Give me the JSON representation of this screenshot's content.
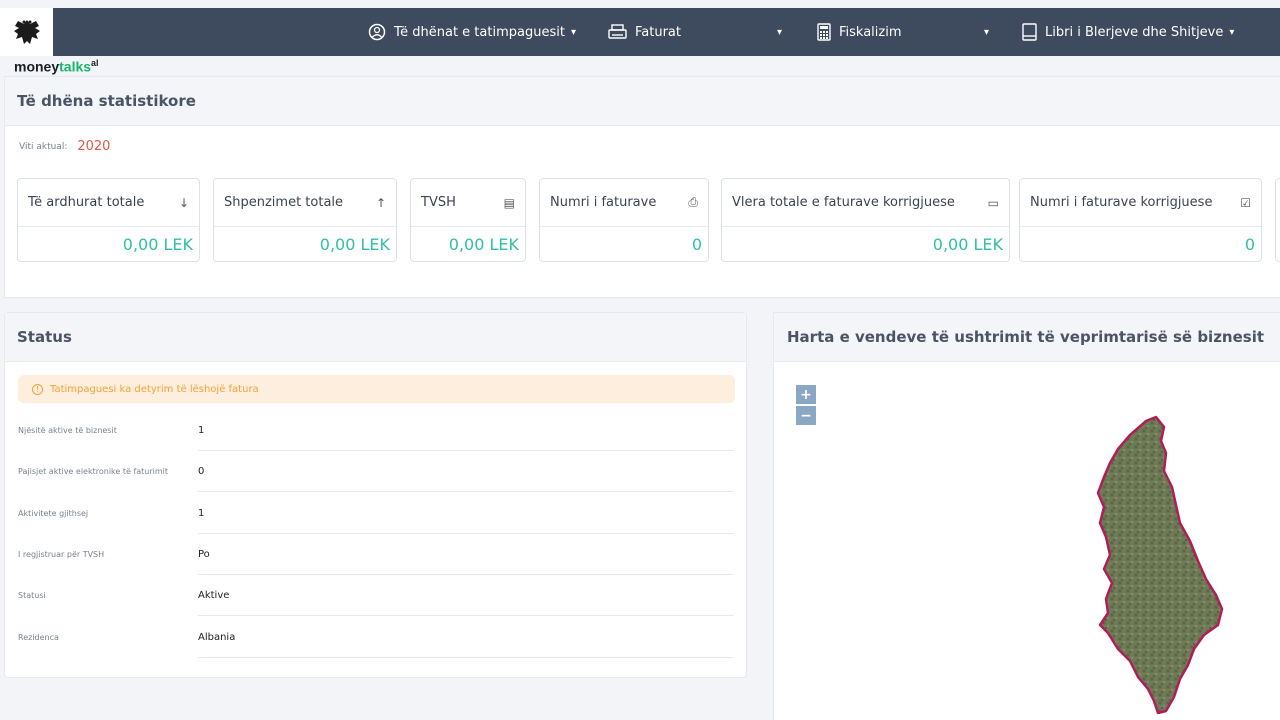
{
  "nav": {
    "items": [
      {
        "label": "Të dhënat e tatimpaguesit",
        "icon": "user-circle-icon"
      },
      {
        "label": "Faturat",
        "icon": "printer-icon"
      },
      {
        "label": "Fiskalizim",
        "icon": "calculator-icon"
      },
      {
        "label": "Libri i Blerjeve dhe Shitjeve",
        "icon": "book-icon"
      }
    ],
    "caret": "▾"
  },
  "brand": {
    "part1": "money",
    "part2": "talks",
    "sup": "al"
  },
  "stats": {
    "title": "Të dhëna statistikore",
    "year_label": "Viti aktual:",
    "year_value": "2020",
    "cards": [
      {
        "label": "Të ardhurat totale",
        "icon": "arrow-down-icon",
        "glyph": "↓",
        "value": "0,00 LEK"
      },
      {
        "label": "Shpenzimet totale",
        "icon": "arrow-up-icon",
        "glyph": "↑",
        "value": "0,00 LEK"
      },
      {
        "label": "TVSH",
        "icon": "calculator-icon",
        "glyph": "▤",
        "value": "0,00 LEK"
      },
      {
        "label": "Numri i faturave",
        "icon": "printer-icon",
        "glyph": "⎙",
        "value": "0"
      },
      {
        "label": "Vlera totale e faturave korrigjuese",
        "icon": "money-icon",
        "glyph": "▭",
        "value": "0,00 LEK"
      },
      {
        "label": "Numri i faturave korrigjuese",
        "icon": "clipboard-icon",
        "glyph": "☑",
        "value": "0"
      }
    ]
  },
  "status": {
    "title": "Status",
    "alert": "Tatimpaguesi ka detyrim të lëshojë fatura",
    "rows": [
      {
        "label": "Njësitë aktive të biznesit",
        "value": "1"
      },
      {
        "label": "Pajisjet aktive elektronike të faturimit",
        "value": "0"
      },
      {
        "label": "Aktivitete gjithsej",
        "value": "1"
      },
      {
        "label": "I regjistruar për TVSH",
        "value": "Po"
      },
      {
        "label": "Statusi",
        "value": "Aktive"
      },
      {
        "label": "Rezidenca",
        "value": "Albania"
      }
    ]
  },
  "map": {
    "title": "Harta e vendeve të ushtrimit të veprimtarisë së biznesit",
    "zoom_in": "+",
    "zoom_out": "−"
  }
}
